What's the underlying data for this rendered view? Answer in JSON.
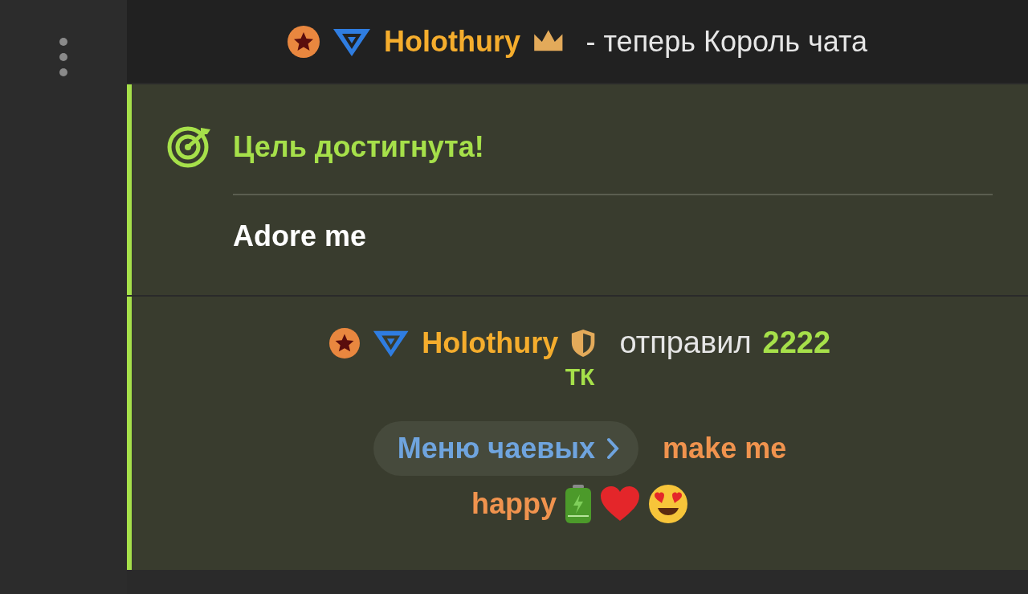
{
  "announcement": {
    "username": "Holothury",
    "text": "- теперь Король чата"
  },
  "goal": {
    "title": "Цель достигнута!",
    "name": "Adore me"
  },
  "tip": {
    "username": "Holothury",
    "verb": "отправил",
    "amount": "2222",
    "unit": "ТК",
    "menu_button": "Меню чаевых",
    "message_lines": [
      "make me",
      "happy"
    ]
  }
}
